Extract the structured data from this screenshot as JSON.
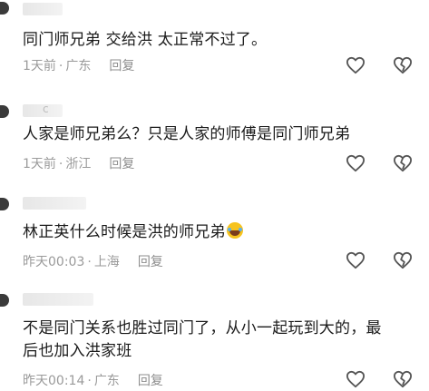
{
  "comments": [
    {
      "username": "",
      "text": "同门师兄弟 交给洪 太正常不过了。",
      "time": "1天前",
      "location": "广东",
      "reply_label": "回复"
    },
    {
      "username": "c",
      "text": "人家是师兄弟么？只是人家的师傅是同门师兄弟",
      "time": "1天前",
      "location": "浙江",
      "reply_label": "回复"
    },
    {
      "username": "",
      "text": "林正英什么时候是洪的师兄弟",
      "emoji": "laughing-with-tears-emoji",
      "time": "昨天00:03",
      "location": "上海",
      "reply_label": "回复"
    },
    {
      "username": "",
      "text_line1": "不是同门关系也胜过同门了，从小一起玩到大的，最",
      "text_line2": "后也加入洪家班",
      "time": "昨天00:14",
      "location": "广东",
      "reply_label": "回复"
    }
  ],
  "separator": "·",
  "icons": {
    "like": "heart-icon",
    "dislike": "broken-heart-icon"
  },
  "colors": {
    "text": "#1a1a1a",
    "meta": "#9a9a9a",
    "icon": "#555555"
  }
}
